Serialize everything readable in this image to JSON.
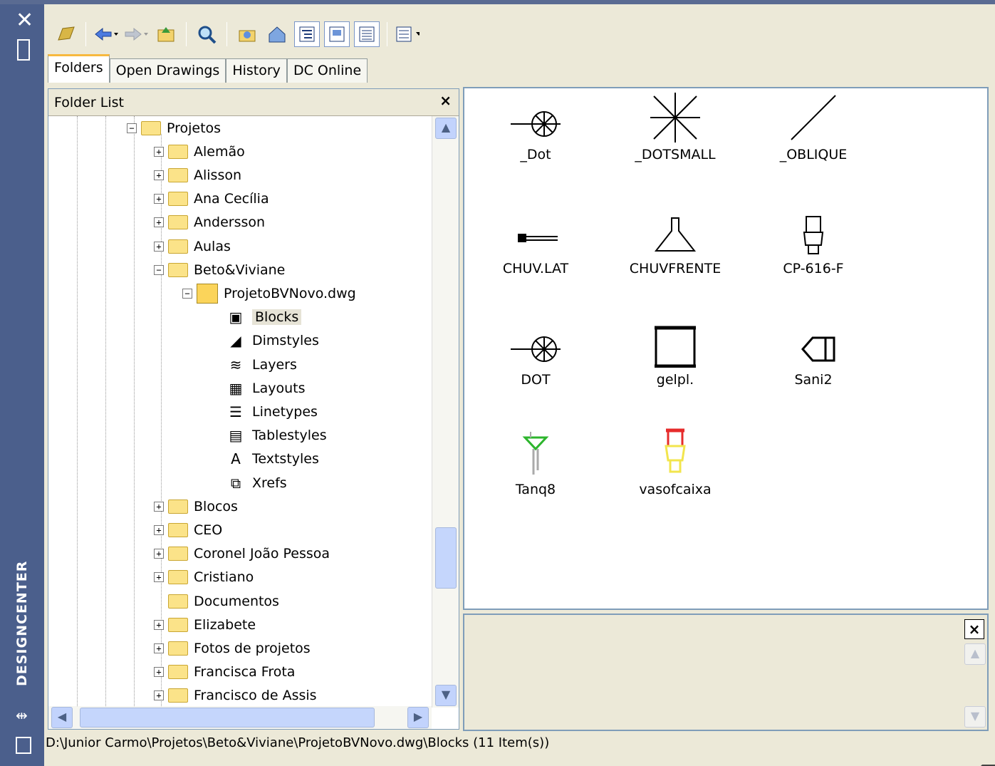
{
  "app": {
    "title": "DESIGNCENTER"
  },
  "toolbar": {
    "buttons": [
      "load-icon",
      "back-icon",
      "forward-icon",
      "up-icon",
      "search-icon",
      "favorites-icon",
      "home-icon",
      "tree-toggle-icon",
      "preview-icon",
      "description-icon",
      "views-icon"
    ]
  },
  "tabs": [
    {
      "label": "Folders"
    },
    {
      "label": "Open Drawings"
    },
    {
      "label": "History"
    },
    {
      "label": "DC Online"
    }
  ],
  "folder_panel": {
    "header": "Folder List",
    "close_glyph": "×",
    "tree": [
      {
        "label": "Projetos",
        "level": 0,
        "exp": "−",
        "kind": "folder"
      },
      {
        "label": "Alemão",
        "level": 1,
        "exp": "+",
        "kind": "folder"
      },
      {
        "label": "Alisson",
        "level": 1,
        "exp": "+",
        "kind": "folder"
      },
      {
        "label": "Ana Cecília",
        "level": 1,
        "exp": "+",
        "kind": "folder"
      },
      {
        "label": "Andersson",
        "level": 1,
        "exp": "+",
        "kind": "folder"
      },
      {
        "label": "Aulas",
        "level": 1,
        "exp": "+",
        "kind": "folder"
      },
      {
        "label": "Beto&Viviane",
        "level": 1,
        "exp": "−",
        "kind": "folder"
      },
      {
        "label": "ProjetoBVNovo.dwg",
        "level": 2,
        "exp": "−",
        "kind": "dwg"
      },
      {
        "label": "Blocks",
        "level": 3,
        "exp": "",
        "kind": "blocks",
        "selected": true
      },
      {
        "label": "Dimstyles",
        "level": 3,
        "exp": "",
        "kind": "dimstyles"
      },
      {
        "label": "Layers",
        "level": 3,
        "exp": "",
        "kind": "layers"
      },
      {
        "label": "Layouts",
        "level": 3,
        "exp": "",
        "kind": "layouts"
      },
      {
        "label": "Linetypes",
        "level": 3,
        "exp": "",
        "kind": "linetypes"
      },
      {
        "label": "Tablestyles",
        "level": 3,
        "exp": "",
        "kind": "tablestyles"
      },
      {
        "label": "Textstyles",
        "level": 3,
        "exp": "",
        "kind": "textstyles"
      },
      {
        "label": "Xrefs",
        "level": 3,
        "exp": "",
        "kind": "xrefs"
      },
      {
        "label": "Blocos",
        "level": 1,
        "exp": "+",
        "kind": "folder"
      },
      {
        "label": "CEO",
        "level": 1,
        "exp": "+",
        "kind": "folder"
      },
      {
        "label": "Coronel João Pessoa",
        "level": 1,
        "exp": "+",
        "kind": "folder"
      },
      {
        "label": "Cristiano",
        "level": 1,
        "exp": "+",
        "kind": "folder"
      },
      {
        "label": "Documentos",
        "level": 1,
        "exp": "",
        "kind": "folder"
      },
      {
        "label": "Elizabete",
        "level": 1,
        "exp": "+",
        "kind": "folder"
      },
      {
        "label": "Fotos de projetos",
        "level": 1,
        "exp": "+",
        "kind": "folder"
      },
      {
        "label": "Francisca Frota",
        "level": 1,
        "exp": "+",
        "kind": "folder"
      },
      {
        "label": "Francisco de Assis",
        "level": 1,
        "exp": "+",
        "kind": "folder"
      }
    ]
  },
  "content": {
    "items": [
      {
        "label": "_Dot",
        "icon": "dot-symbol-icon"
      },
      {
        "label": "_DOTSMALL",
        "icon": "dotsmall-symbol-icon"
      },
      {
        "label": "_OBLIQUE",
        "icon": "oblique-symbol-icon"
      },
      {
        "label": "CHUV.LAT",
        "icon": "shower-side-icon"
      },
      {
        "label": "CHUVFRENTE",
        "icon": "shower-front-icon"
      },
      {
        "label": "CP-616-F",
        "icon": "toilet-front-icon"
      },
      {
        "label": "DOT",
        "icon": "dot-symbol-icon"
      },
      {
        "label": "gelpl.",
        "icon": "fridge-plan-icon"
      },
      {
        "label": "Sani2",
        "icon": "toilet-plan-icon"
      },
      {
        "label": "Tanq8",
        "icon": "tank-icon"
      },
      {
        "label": "vasofcaixa",
        "icon": "toilet-box-icon"
      }
    ]
  },
  "preview": {
    "close_glyph": "×"
  },
  "status": {
    "text": "D:\\Junior Carmo\\Projetos\\Beto&Viviane\\ProjetoBVNovo.dwg\\Blocks (11 Item(s))"
  }
}
